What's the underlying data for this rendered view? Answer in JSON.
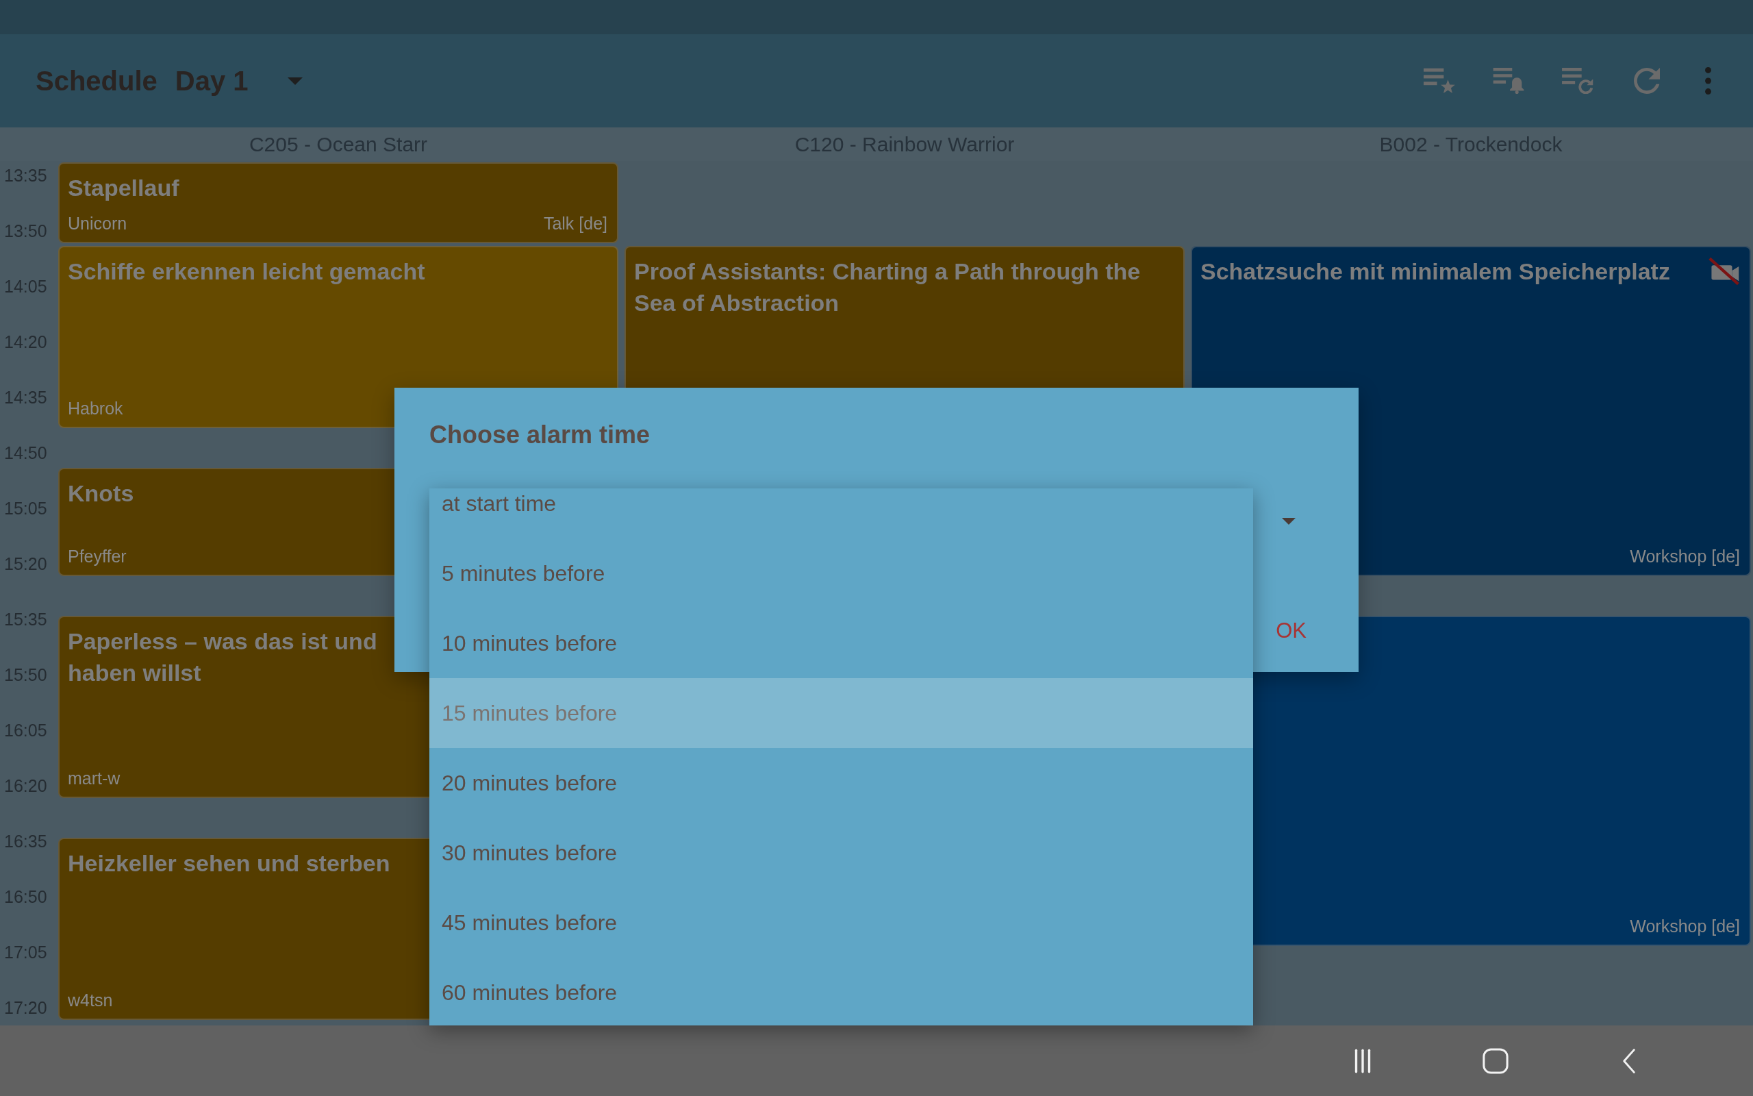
{
  "app_bar": {
    "title": "Schedule",
    "day": "Day 1"
  },
  "schedule": {
    "times": [
      "13:35",
      "13:50",
      "14:05",
      "14:20",
      "14:35",
      "14:50",
      "15:05",
      "15:20",
      "15:35",
      "15:50",
      "16:05",
      "16:20",
      "16:35",
      "16:50",
      "17:05",
      "17:20"
    ],
    "columns": [
      {
        "room": "C205 - Ocean Starr",
        "events": [
          {
            "title": "Stapellauf",
            "speaker": "Unicorn",
            "type": "Talk [de]",
            "color": "#553d00",
            "no_recording": false
          },
          {
            "title": "Schiffe erkennen leicht gemacht",
            "speaker": "Habrok",
            "color": "#654a00",
            "no_recording": false
          },
          {
            "title": "Knots",
            "speaker": "Pfeyffer",
            "color": "#553d00",
            "no_recording": false
          },
          {
            "title": "Paperless – was das ist und\nhaben willst",
            "speaker": "mart-w",
            "color": "#553d00",
            "no_recording": false
          },
          {
            "title": "Heizkeller sehen und sterben",
            "speaker": "w4tsn",
            "color": "#553d00",
            "no_recording": false
          }
        ]
      },
      {
        "room": "C120 - Rainbow Warrior",
        "events": [
          {
            "title": "Proof Assistants: Charting a Path through the Sea of Abstraction",
            "color": "#543c00",
            "no_recording": false
          }
        ]
      },
      {
        "room": "B002 - Trockendock",
        "events": [
          {
            "title": "Schatzsuche mit minimalem Speicherplatz",
            "type": "Workshop [de]",
            "color": "#002a4e",
            "no_recording": true
          },
          {
            "type": "Workshop [de]",
            "color": "#00335f",
            "no_recording": false
          }
        ]
      }
    ]
  },
  "dialog": {
    "title": "Choose alarm time",
    "options": [
      {
        "label": "at start time",
        "selected": false
      },
      {
        "label": "5 minutes before",
        "selected": false
      },
      {
        "label": "10 minutes before",
        "selected": false
      },
      {
        "label": "15 minutes before",
        "selected": true
      },
      {
        "label": "20 minutes before",
        "selected": false
      },
      {
        "label": "30 minutes before",
        "selected": false
      },
      {
        "label": "45 minutes before",
        "selected": false
      },
      {
        "label": "60 minutes before",
        "selected": false
      }
    ],
    "ok": "OK"
  }
}
